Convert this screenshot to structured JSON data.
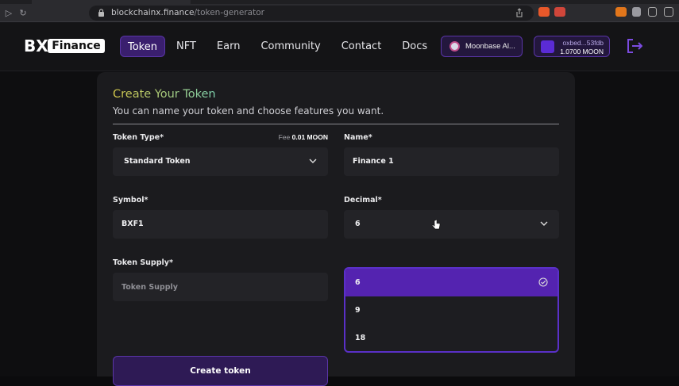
{
  "browser": {
    "url_host": "blockchainx.finance",
    "url_path": "/token-generator"
  },
  "header": {
    "logo_text": "Finance",
    "logo_mark": "BX",
    "nav": [
      {
        "label": "Token",
        "active": true
      },
      {
        "label": "NFT",
        "active": false
      },
      {
        "label": "Earn",
        "active": false
      },
      {
        "label": "Community",
        "active": false
      },
      {
        "label": "Contact",
        "active": false
      },
      {
        "label": "Docs",
        "active": false
      }
    ],
    "network_label": "Moonbase Al...",
    "wallet_address": "oxbed...53fdb",
    "wallet_balance": "1.0700 MOON"
  },
  "form": {
    "title": "Create Your Token",
    "subtitle": "You can name your token and choose features you want.",
    "token_type_label": "Token Type*",
    "fee_prefix": "Fee",
    "fee_value": "0.01 MOON",
    "token_type_value": "Standard Token",
    "name_label": "Name*",
    "name_value": "Finance 1",
    "symbol_label": "Symbol*",
    "symbol_value": "BXF1",
    "decimal_label": "Decimal*",
    "decimal_value": "6",
    "decimal_options": [
      "6",
      "9",
      "18"
    ],
    "supply_label": "Token Supply*",
    "supply_placeholder": "Token Supply",
    "create_button": "Create token"
  },
  "colors": {
    "accent": "#5423b0",
    "accent_border": "#5a35a8",
    "card_bg": "#1b1b1e",
    "field_bg": "#232327"
  }
}
